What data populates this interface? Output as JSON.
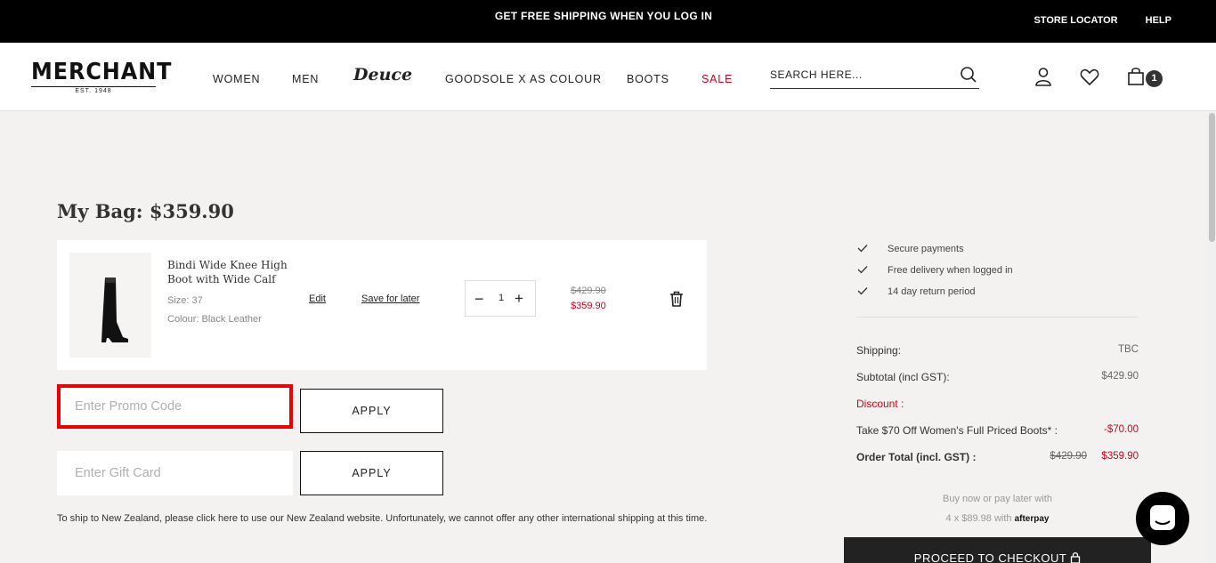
{
  "topbar": {
    "promo": "GET FREE SHIPPING WHEN YOU LOG IN",
    "store_locator": "STORE LOCATOR",
    "help": "HELP"
  },
  "header": {
    "logo": "MERCHANT",
    "logo_tagline": "EST. 1948",
    "nav": [
      "WOMEN",
      "MEN",
      "Deuce",
      "GOODSOLE X AS COLOUR",
      "BOOTS",
      "SALE"
    ],
    "search_placeholder": "SEARCH HERE...",
    "cart_count": "1"
  },
  "bag": {
    "title": "My Bag: $359.90",
    "item": {
      "name": "Bindi Wide Knee High Boot with Wide Calf",
      "size": "Size: 37",
      "colour": "Colour: Black Leather",
      "edit": "Edit",
      "save_for_later": "Save for later",
      "qty": "1",
      "price_old": "$429.90",
      "price_new": "$359.90"
    },
    "promo_placeholder": "Enter Promo Code",
    "gift_placeholder": "Enter Gift Card",
    "apply_label": "APPLY",
    "note": "To ship to New Zealand, please click here to use our New Zealand website. Unfortunately, we cannot offer any other international shipping at this time."
  },
  "summary": {
    "benefits": [
      "Secure payments",
      "Free delivery when logged in",
      "14 day return period"
    ],
    "shipping_label": "Shipping:",
    "shipping_value": "TBC",
    "subtotal_label": "Subtotal (incl GST):",
    "subtotal_value": "$429.90",
    "discount_label": "Discount :",
    "discount_desc": "Take $70 Off Women's Full Priced Boots* :",
    "discount_value": "-$70.00",
    "total_label": "Order Total (incl. GST) :",
    "total_old": "$429.90",
    "total_new": "$359.90",
    "afterpay_line1": "Buy now or pay later with",
    "afterpay_line2": "4 x $89.98 with",
    "afterpay_brand": "afterpay",
    "checkout": "PROCEED TO CHECKOUT"
  },
  "colors": {
    "accent_red": "#d0021b",
    "topbar": "#000000",
    "highlight": "#ee0000"
  }
}
